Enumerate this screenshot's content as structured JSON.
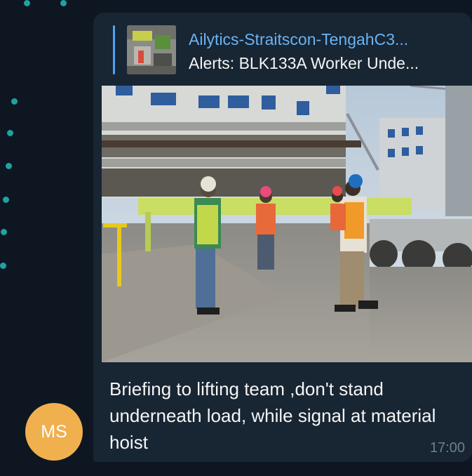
{
  "message": {
    "reply": {
      "chat_name": "Ailytics-Straitscon-TengahC3...",
      "text": "Alerts: BLK133A Worker Unde..."
    },
    "photo": "construction-site-briefing-photo",
    "caption": "Briefing to lifting team ,don't stand underneath load, while signal at material hoist",
    "time": "17:00"
  },
  "sender": {
    "initials": "MS",
    "avatar_color": "#f0b04e"
  },
  "colors": {
    "background": "#0e1621",
    "bubble": "#182533",
    "reply_accent": "#4ea4f6",
    "reply_name": "#6ab3f3",
    "wallpaper_dot": "#1fa3a0"
  }
}
